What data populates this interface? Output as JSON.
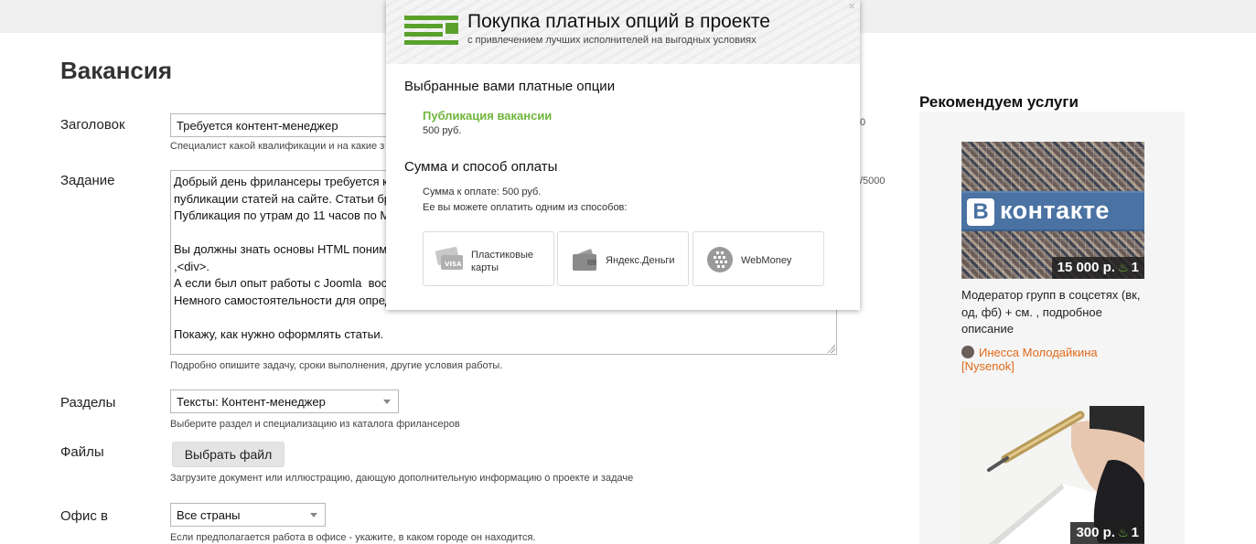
{
  "page": {
    "title": "Вакансия"
  },
  "form": {
    "title_label": "Заголовок",
    "title_value": "Требуется контент-менеджер",
    "title_hint": "Специалист какой квалификации и на какие з",
    "title_counter": "0",
    "task_label": "Задание",
    "task_lines": [
      "Добрый день фрилансеры требуется к",
      "публикации статей на сайте. Статьи бр",
      "Публикация по утрам до 11 часов по М",
      "",
      "Вы должны знать основы HTML поним",
      ",<div>.",
      "А если был опыт работы с Joomla  вос",
      "Немного самостоятельности для опред",
      "",
      "Покажу, как нужно оформлять статьи."
    ],
    "task_counter": "/5000",
    "task_hint": "Подробно опишите задачу, сроки выполнения, другие условия работы.",
    "sections_label": "Разделы",
    "sections_value": "Тексты: Контент-менеджер",
    "sections_hint": "Выберите раздел и специализацию из каталога фрилансеров",
    "files_label": "Файлы",
    "files_button": "Выбрать файл",
    "files_hint": "Загрузите документ или иллюстрацию, дающую дополнительную информацию о проекте и задаче",
    "office_label": "Офис в",
    "office_value": "Все страны",
    "office_hint": "Если предполагается работа в офисе - укажите, в каком городе он находится."
  },
  "sidebar": {
    "title": "Рекомендуем услуги",
    "services": [
      {
        "image_text": "контакте",
        "image_logo": "B",
        "price": "15 000 р.",
        "count": "1",
        "description": "Модератор групп в соцсетях (вк, од, фб) + см. , подробное описание",
        "author": "Инесса Молодайкина [Nysenok]"
      },
      {
        "price": "300 р.",
        "count": "1"
      }
    ]
  },
  "modal": {
    "close": "×",
    "title": "Покупка платных опций в проекте",
    "subtitle": "с привлечением лучших исполнителей на выгодных условиях",
    "selected_heading": "Выбранные вами платные опции",
    "option_name": "Публикация вакансии",
    "option_price": "500 руб.",
    "payment_heading": "Сумма и способ оплаты",
    "amount_text": "Сумма к оплате: 500 руб.",
    "methods_text": "Ее вы можете оплатить одним из способов:",
    "methods": [
      {
        "label_1": "Пластиковые",
        "label_2": "карты",
        "icon": "card-icon"
      },
      {
        "label_1": "Яндекс.Деньги",
        "icon": "wallet-icon"
      },
      {
        "label_1": "WebMoney",
        "icon": "globe-icon"
      }
    ]
  },
  "colors": {
    "accent_green": "#5aa12c",
    "link_orange": "#e06a1a",
    "vk_blue": "#4a72a3"
  }
}
